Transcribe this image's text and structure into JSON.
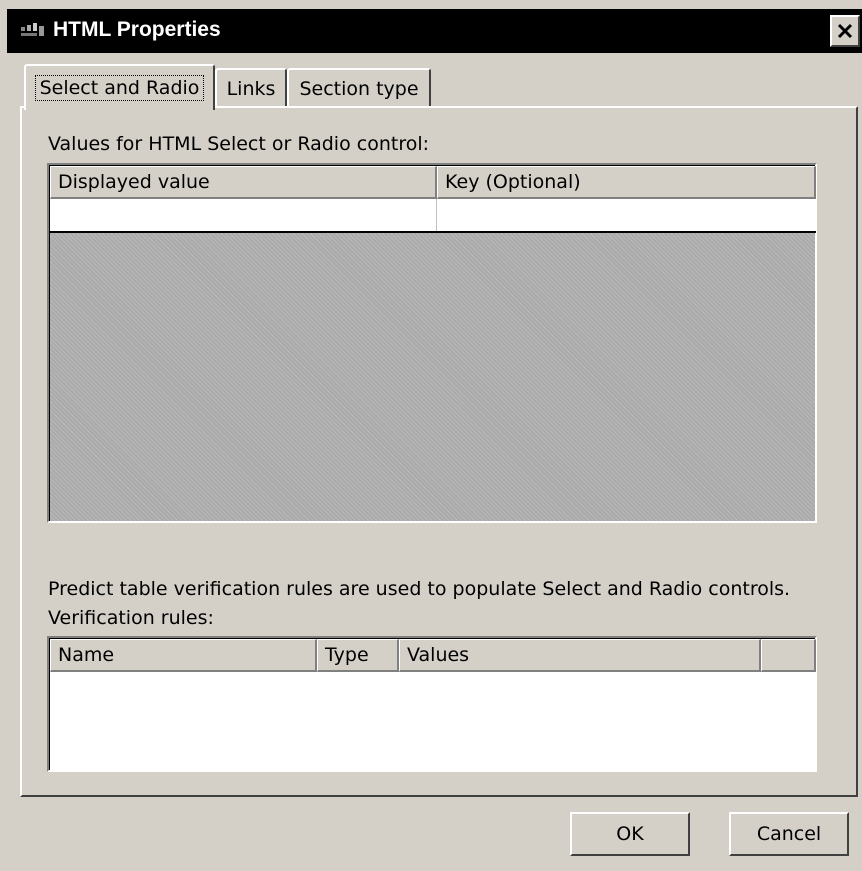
{
  "window": {
    "title": "HTML Properties",
    "icon": "app-icon",
    "close_icon": "close-icon"
  },
  "tabs": [
    {
      "label": "Select and Radio",
      "active": true
    },
    {
      "label": "Links",
      "active": false
    },
    {
      "label": "Section type",
      "active": false
    }
  ],
  "values_section": {
    "label": "Values for HTML Select or Radio control:",
    "columns": [
      "Displayed value",
      "Key (Optional)"
    ],
    "rows": [
      [
        "",
        ""
      ]
    ]
  },
  "verification_section": {
    "note": "Predict table verification rules are used to populate Select and Radio controls.",
    "label": "Verification rules:",
    "columns": [
      "Name",
      "Type",
      "Values",
      ""
    ],
    "rows": []
  },
  "buttons": {
    "ok": "OK",
    "cancel": "Cancel"
  }
}
